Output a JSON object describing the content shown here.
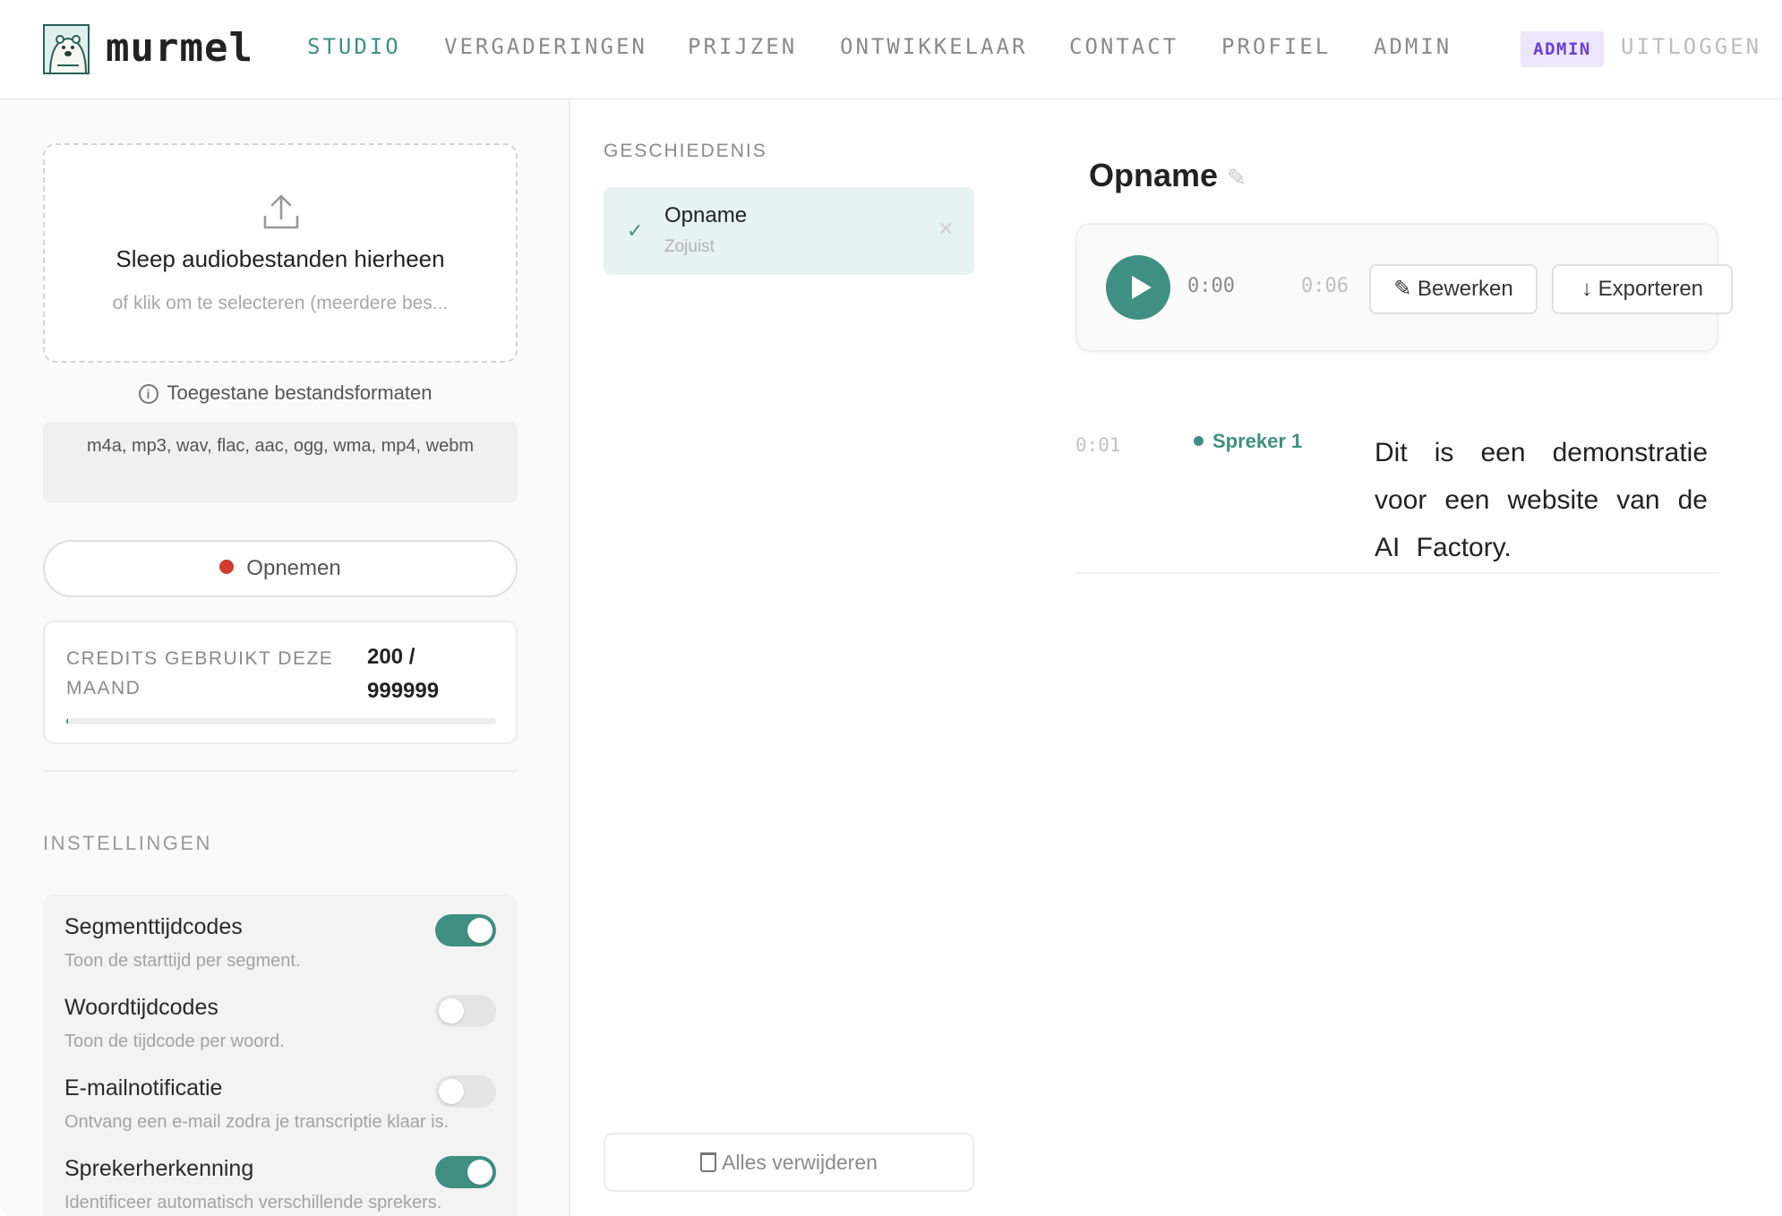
{
  "brand": {
    "name": "murmel",
    "logo_icon": "polar-bear-logo-icon"
  },
  "nav": {
    "items": [
      {
        "label": "STUDIO",
        "active": true
      },
      {
        "label": "VERGADERINGEN",
        "active": false
      },
      {
        "label": "PRIJZEN",
        "active": false
      },
      {
        "label": "ONTWIKKELAAR",
        "active": false
      },
      {
        "label": "CONTACT",
        "active": false
      },
      {
        "label": "PROFIEL",
        "active": false
      },
      {
        "label": "ADMIN",
        "active": false
      }
    ],
    "admin_badge": "ADMIN",
    "logout": "UITLOGGEN"
  },
  "upload": {
    "title": "Sleep audiobestanden hierheen",
    "subtitle": "of klik om te selecteren (meerdere bes...",
    "icon": "upload-icon",
    "formats_heading": "Toegestane bestandsformaten",
    "formats": "m4a, mp3, wav, flac, aac, ogg, wma, mp4, webm"
  },
  "record": {
    "label": "Opnemen"
  },
  "credits": {
    "label": "CREDITS GEBRUIKT DEZE MAAND",
    "value": "200 / 999999",
    "used_fraction": 0.0002
  },
  "settings": {
    "heading": "INSTELLINGEN",
    "items": [
      {
        "title": "Segmenttijdcodes",
        "description": "Toon de starttijd per segment.",
        "enabled": true
      },
      {
        "title": "Woordtijdcodes",
        "description": "Toon de tijdcode per woord.",
        "enabled": false
      },
      {
        "title": "E-mailnotificatie",
        "description": "Ontvang een e-mail zodra je transcriptie klaar is.",
        "enabled": false
      },
      {
        "title": "Sprekerherkenning",
        "description": "Identificeer automatisch verschillende sprekers.",
        "enabled": true
      }
    ]
  },
  "history": {
    "heading": "GESCHIEDENIS",
    "items": [
      {
        "title": "Opname",
        "time": "Zojuist",
        "status_icon": "check-icon",
        "close_icon": "close-icon"
      }
    ],
    "delete_all": "Alles verwijderen"
  },
  "transcript": {
    "title": "Opname",
    "player": {
      "current": "0:00",
      "total": "0:06",
      "edit_label": "✎ Bewerken",
      "export_label": "↓ Exporteren"
    },
    "segments": [
      {
        "time": "0:01",
        "speaker": "Spreker 1",
        "text": "Dit is een demonstratie voor een website van de AI Factory."
      }
    ]
  },
  "colors": {
    "accent": "#3f8f82",
    "admin_badge_bg": "#ece6fb",
    "admin_badge_text": "#6b3fd4",
    "record_dot": "#d13b30"
  }
}
